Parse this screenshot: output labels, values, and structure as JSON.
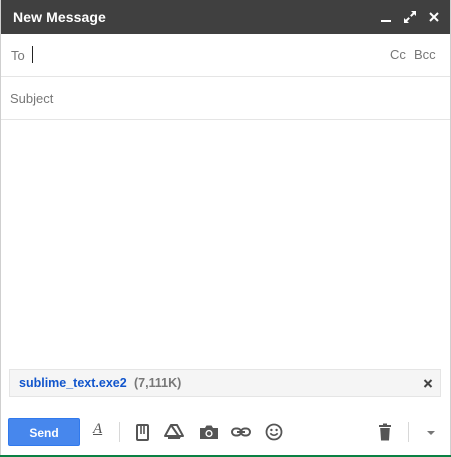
{
  "window": {
    "title": "New Message"
  },
  "to": {
    "label": "To",
    "value": "",
    "cc_label": "Cc",
    "bcc_label": "Bcc"
  },
  "subject": {
    "placeholder": "Subject",
    "value": ""
  },
  "attachment": {
    "name": "sublime_text.exe2",
    "size": "(7,111K)"
  },
  "toolbar": {
    "send_label": "Send",
    "icons": [
      "format-text-icon",
      "attach-icon",
      "drive-icon",
      "photo-icon",
      "link-icon",
      "emoji-icon",
      "trash-icon",
      "more-options-icon"
    ]
  },
  "colors": {
    "titlebar": "#404040",
    "send_button": "#4787ed",
    "attachment_link": "#1155cc",
    "bottom_bar": "#0a8043"
  }
}
